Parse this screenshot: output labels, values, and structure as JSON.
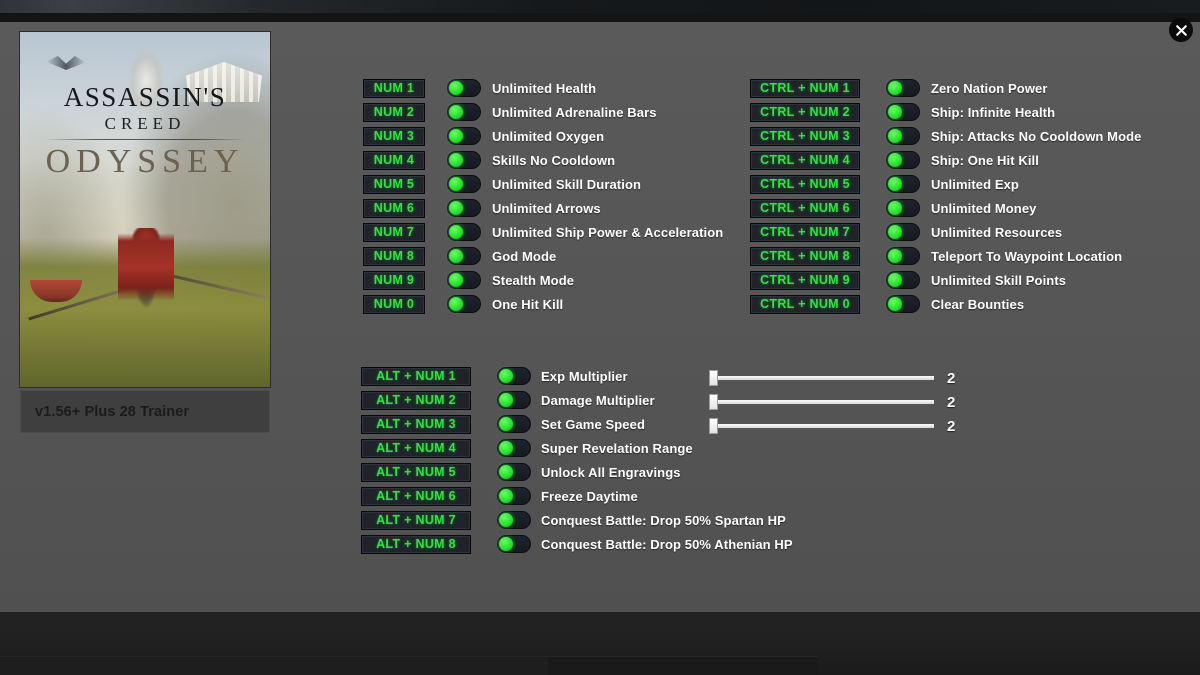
{
  "window": {
    "close_label": "×"
  },
  "game": {
    "title_line1": "ASSASSIN'S",
    "title_line2": "CREED",
    "title_line3": "ODYSSEY",
    "version": "v1.56+ Plus 28 Trainer"
  },
  "colors": {
    "hotkey_text": "#2fe341",
    "toggle_on": "#27e332",
    "label_text": "#ffffff",
    "panel_bg": "#565656"
  },
  "columns": {
    "num": [
      {
        "hotkey": "NUM 1",
        "label": "Unlimited Health",
        "state": "on"
      },
      {
        "hotkey": "NUM 2",
        "label": "Unlimited  Adrenaline Bars",
        "state": "on"
      },
      {
        "hotkey": "NUM 3",
        "label": "Unlimited  Oxygen",
        "state": "on"
      },
      {
        "hotkey": "NUM 4",
        "label": "Skills No Cooldown",
        "state": "on"
      },
      {
        "hotkey": "NUM 5",
        "label": "Unlimited Skill Duration",
        "state": "on"
      },
      {
        "hotkey": "NUM 6",
        "label": "Unlimited Arrows",
        "state": "on"
      },
      {
        "hotkey": "NUM 7",
        "label": "Unlimited Ship Power & Acceleration",
        "state": "on"
      },
      {
        "hotkey": "NUM 8",
        "label": "God Mode",
        "state": "on"
      },
      {
        "hotkey": "NUM 9",
        "label": "Stealth Mode",
        "state": "on"
      },
      {
        "hotkey": "NUM 0",
        "label": "One Hit Kill",
        "state": "on"
      }
    ],
    "ctrl": [
      {
        "hotkey": "CTRL + NUM 1",
        "label": "Zero Nation Power",
        "state": "on"
      },
      {
        "hotkey": "CTRL + NUM 2",
        "label": "Ship: Infinite Health",
        "state": "on"
      },
      {
        "hotkey": "CTRL + NUM 3",
        "label": "Ship: Attacks No Cooldown Mode",
        "state": "on"
      },
      {
        "hotkey": "CTRL + NUM 4",
        "label": "Ship: One Hit Kill",
        "state": "on"
      },
      {
        "hotkey": "CTRL + NUM 5",
        "label": "Unlimited Exp",
        "state": "on"
      },
      {
        "hotkey": "CTRL + NUM 6",
        "label": "Unlimited Money",
        "state": "on"
      },
      {
        "hotkey": "CTRL + NUM 7",
        "label": "Unlimited Resources",
        "state": "on"
      },
      {
        "hotkey": "CTRL + NUM 8",
        "label": "Teleport To Waypoint Location",
        "state": "on"
      },
      {
        "hotkey": "CTRL + NUM 9",
        "label": "Unlimited Skill Points",
        "state": "on"
      },
      {
        "hotkey": "CTRL + NUM 0",
        "label": "Clear Bounties",
        "state": "on"
      }
    ],
    "alt": [
      {
        "hotkey": "ALT + NUM 1",
        "label": "Exp Multiplier",
        "state": "on"
      },
      {
        "hotkey": "ALT + NUM 2",
        "label": "Damage Multiplier",
        "state": "on"
      },
      {
        "hotkey": "ALT + NUM 3",
        "label": "Set Game Speed",
        "state": "on"
      },
      {
        "hotkey": "ALT + NUM 4",
        "label": "Super Revelation Range",
        "state": "on"
      },
      {
        "hotkey": "ALT + NUM 5",
        "label": "Unlock All Engravings",
        "state": "on"
      },
      {
        "hotkey": "ALT + NUM 6",
        "label": "Freeze Daytime",
        "state": "on"
      },
      {
        "hotkey": "ALT + NUM 7",
        "label": "Conquest Battle: Drop 50% Spartan HP",
        "state": "on"
      },
      {
        "hotkey": "ALT + NUM 8",
        "label": "Conquest Battle: Drop 50% Athenian HP",
        "state": "on"
      }
    ]
  },
  "sliders": [
    {
      "for": "Exp Multiplier",
      "value": "2",
      "position": 0
    },
    {
      "for": "Damage Multiplier",
      "value": "2",
      "position": 0
    },
    {
      "for": "Set Game Speed",
      "value": "2",
      "position": 0
    }
  ]
}
